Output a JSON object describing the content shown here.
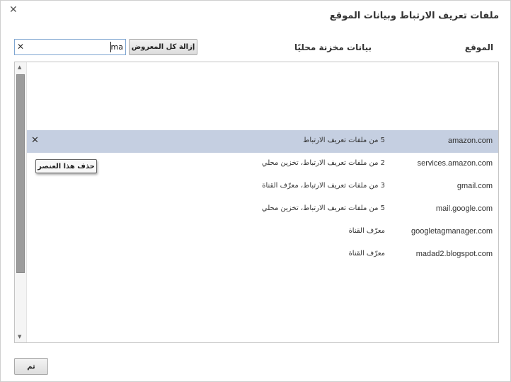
{
  "dialog": {
    "title": "ملفات تعريف الارتباط وبيانات الموقع",
    "close_icon": "✕"
  },
  "columns": {
    "site": "الموقع",
    "locally_stored": "بيانات مخزنة محليًا"
  },
  "toolbar": {
    "remove_all_label": "إزالة كل المعروض",
    "search_value": "ma",
    "search_clear_icon": "✕"
  },
  "rows": [
    {
      "site": "amazon.com",
      "data": "5 من ملفات تعريف الارتباط",
      "selected": true,
      "remove_icon": "✕"
    },
    {
      "site": "services.amazon.com",
      "data": "2 من ملفات تعريف الارتباط، تخزين محلي"
    },
    {
      "site": "gmail.com",
      "data": "3 من ملفات تعريف الارتباط، معرّف القناة"
    },
    {
      "site": "mail.google.com",
      "data": "5 من ملفات تعريف الارتباط، تخزين محلي"
    },
    {
      "site": "googletagmanager.com",
      "data": "معرّف القناة"
    },
    {
      "site": "madad2.blogspot.com",
      "data": "معرّف القناة"
    }
  ],
  "tooltip": {
    "text": "حذف هذا العنصر"
  },
  "footer": {
    "done_label": "تم"
  },
  "scrollbar": {
    "up_arrow": "▲",
    "down_arrow": "▼"
  },
  "colors": {
    "selected_row": "#c5cfe1",
    "search_border": "#7fa6d1"
  }
}
